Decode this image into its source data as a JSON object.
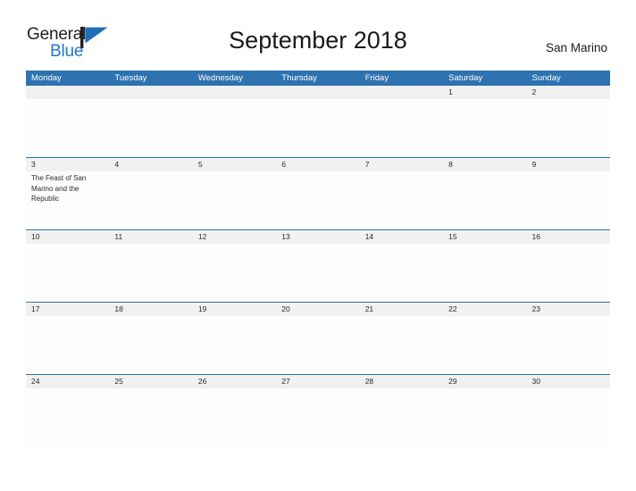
{
  "brand": {
    "name_part1": "General",
    "name_part2": "Blue",
    "mark": "flag-triangle-icon",
    "accent_color": "#2277c8"
  },
  "header": {
    "title": "September 2018",
    "location": "San Marino"
  },
  "theme": {
    "header_blue": "#2f72b0",
    "number_band": "#f1f1f1",
    "cell_background": "#fdfdfd",
    "text": "#2b2b2b"
  },
  "calendar": {
    "weekday_headers": [
      "Monday",
      "Tuesday",
      "Wednesday",
      "Thursday",
      "Friday",
      "Saturday",
      "Sunday"
    ],
    "weeks": [
      {
        "days": [
          {
            "number": "",
            "events": []
          },
          {
            "number": "",
            "events": []
          },
          {
            "number": "",
            "events": []
          },
          {
            "number": "",
            "events": []
          },
          {
            "number": "",
            "events": []
          },
          {
            "number": "1",
            "events": []
          },
          {
            "number": "2",
            "events": []
          }
        ]
      },
      {
        "days": [
          {
            "number": "3",
            "events": [
              "The Feast of San Marino and the Republic"
            ]
          },
          {
            "number": "4",
            "events": []
          },
          {
            "number": "5",
            "events": []
          },
          {
            "number": "6",
            "events": []
          },
          {
            "number": "7",
            "events": []
          },
          {
            "number": "8",
            "events": []
          },
          {
            "number": "9",
            "events": []
          }
        ]
      },
      {
        "days": [
          {
            "number": "10",
            "events": []
          },
          {
            "number": "11",
            "events": []
          },
          {
            "number": "12",
            "events": []
          },
          {
            "number": "13",
            "events": []
          },
          {
            "number": "14",
            "events": []
          },
          {
            "number": "15",
            "events": []
          },
          {
            "number": "16",
            "events": []
          }
        ]
      },
      {
        "days": [
          {
            "number": "17",
            "events": []
          },
          {
            "number": "18",
            "events": []
          },
          {
            "number": "19",
            "events": []
          },
          {
            "number": "20",
            "events": []
          },
          {
            "number": "21",
            "events": []
          },
          {
            "number": "22",
            "events": []
          },
          {
            "number": "23",
            "events": []
          }
        ]
      },
      {
        "days": [
          {
            "number": "24",
            "events": []
          },
          {
            "number": "25",
            "events": []
          },
          {
            "number": "26",
            "events": []
          },
          {
            "number": "27",
            "events": []
          },
          {
            "number": "28",
            "events": []
          },
          {
            "number": "29",
            "events": []
          },
          {
            "number": "30",
            "events": []
          }
        ]
      }
    ]
  }
}
